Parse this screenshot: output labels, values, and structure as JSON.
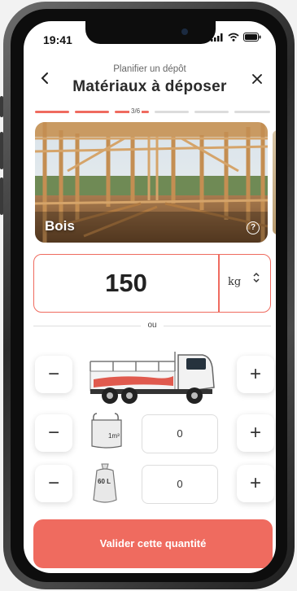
{
  "status_bar": {
    "time": "19:41"
  },
  "header": {
    "subtitle": "Planifier un dépôt",
    "title": "Matériaux à déposer",
    "back_icon": "chevron-left-icon",
    "close_icon": "close-icon"
  },
  "progress": {
    "step_label": "3/6",
    "current_step": 3,
    "total_steps": 6,
    "accent": "#ef6b5f",
    "inactive": "#dcdcdc"
  },
  "material": {
    "name": "Bois",
    "info_icon": "info-icon"
  },
  "quantity": {
    "value": "150",
    "unit": "kg",
    "unit_chevrons": "up-down-chevron-icon"
  },
  "separator": {
    "label": "ou"
  },
  "truck_row": {
    "minus": "−",
    "plus": "+",
    "image": "truck-icon"
  },
  "bigbag_row": {
    "minus": "−",
    "plus": "+",
    "count": "0",
    "label": "1m³",
    "image": "big-bag-icon"
  },
  "bag_row": {
    "minus": "−",
    "plus": "+",
    "count": "0",
    "label": "60 L",
    "image": "bag-icon"
  },
  "validate_button": {
    "label": "Valider cette quantité",
    "color": "#ef6b5f"
  }
}
